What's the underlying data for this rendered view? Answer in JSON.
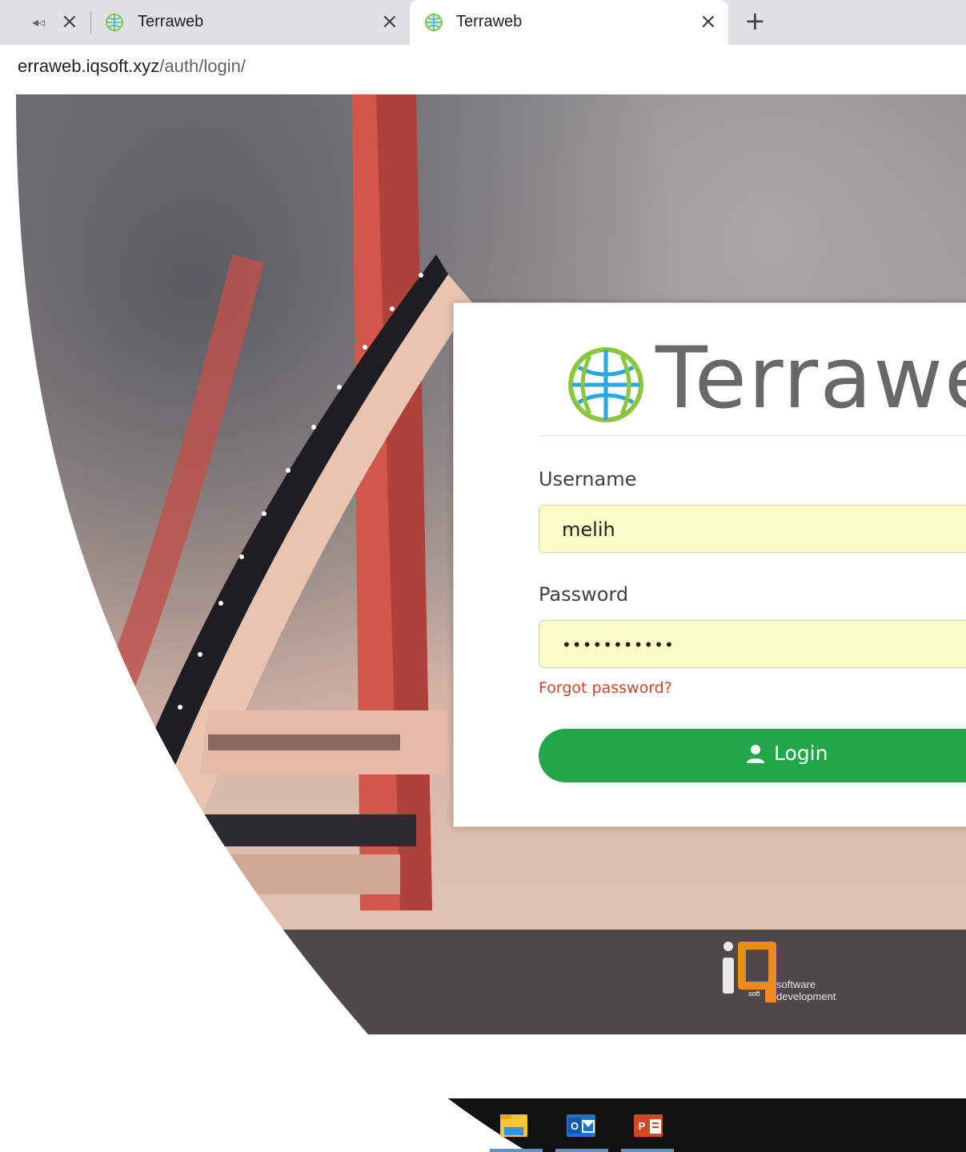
{
  "browser": {
    "tabs": [
      {
        "title": "Terraweb",
        "active": false
      },
      {
        "title": "Terraweb",
        "active": true
      }
    ],
    "url_host": "erraweb.iqsoft.xyz",
    "url_path": "/auth/login/"
  },
  "login": {
    "brand_name": "Terrawel",
    "username_label": "Username",
    "username_value": "melih",
    "password_label": "Password",
    "password_value": "•••••••••••",
    "forgot_label": "Forgot password?",
    "login_button": "Login"
  },
  "footer": {
    "logo_sub1": "software",
    "logo_sub2": "development",
    "logo_tag": "soft"
  },
  "colors": {
    "accent_green": "#22a64a",
    "input_bg": "#fafdc8",
    "link": "#c0492f",
    "footer": "#4f4849"
  },
  "icons": [
    "mute-icon",
    "close-icon",
    "new-tab-icon",
    "user-icon",
    "file-explorer-icon",
    "outlook-icon",
    "powerpoint-icon"
  ]
}
